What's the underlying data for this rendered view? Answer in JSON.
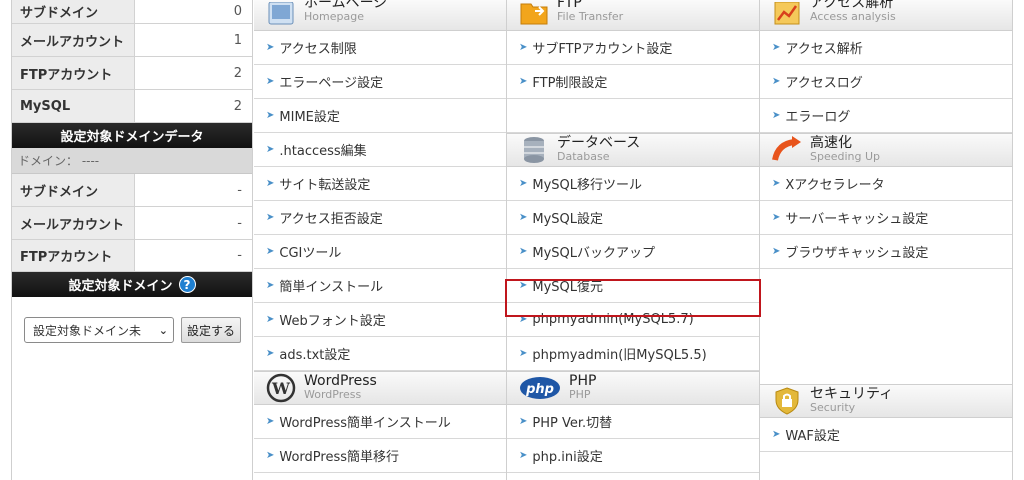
{
  "left": {
    "stats_top": [
      {
        "label": "サブドメイン",
        "value": "0"
      },
      {
        "label": "メールアカウント",
        "value": "1"
      },
      {
        "label": "FTPアカウント",
        "value": "2"
      },
      {
        "label": "MySQL",
        "value": "2"
      }
    ],
    "target_domain_data_header": "設定対象ドメインデータ",
    "domain_line": "ドメイン： ----",
    "stats_target": [
      {
        "label": "サブドメイン",
        "value": "-"
      },
      {
        "label": "メールアカウント",
        "value": "-"
      },
      {
        "label": "FTPアカウント",
        "value": "-"
      }
    ],
    "target_domain_header": "設定対象ドメイン",
    "help_icon": "?",
    "select_value": "設定対象ドメイン未",
    "set_button": "設定する"
  },
  "col1": {
    "head": {
      "title": "ホームページ",
      "sub": "Homepage"
    },
    "items": [
      "アクセス制限",
      "エラーページ設定",
      "MIME設定",
      ".htaccess編集",
      "サイト転送設定",
      "アクセス拒否設定",
      "CGIツール",
      "簡単インストール",
      "Webフォント設定",
      "ads.txt設定"
    ],
    "head2": {
      "title": "WordPress",
      "sub": "WordPress"
    },
    "items2": [
      "WordPress簡単インストール",
      "WordPress簡単移行"
    ]
  },
  "col2": {
    "head": {
      "title": "FTP",
      "sub": "File Transfer"
    },
    "items": [
      "サブFTPアカウント設定",
      "FTP制限設定"
    ],
    "head2": {
      "title": "データベース",
      "sub": "Database"
    },
    "items2": [
      "MySQL移行ツール",
      "MySQL設定",
      "MySQLバックアップ",
      "MySQL復元",
      "phpmyadmin(MySQL5.7)",
      "phpmyadmin(旧MySQL5.5)"
    ],
    "head3": {
      "title": "PHP",
      "sub": "PHP",
      "logo": "php"
    },
    "items3": [
      "PHP Ver.切替",
      "php.ini設定"
    ]
  },
  "col3": {
    "head": {
      "title": "アクセス解析",
      "sub": "Access analysis"
    },
    "items": [
      "アクセス解析",
      "アクセスログ",
      "エラーログ"
    ],
    "head2": {
      "title": "高速化",
      "sub": "Speeding Up"
    },
    "items2": [
      "Xアクセラレータ",
      "サーバーキャッシュ設定",
      "ブラウザキャッシュ設定"
    ],
    "head3": {
      "title": "セキュリティ",
      "sub": "Security"
    },
    "items3": [
      "WAF設定"
    ]
  },
  "colors": {
    "highlight": "#c0161d",
    "help": "#1e7fd0",
    "php": "#1f57a6",
    "speed": "#e8541c"
  }
}
